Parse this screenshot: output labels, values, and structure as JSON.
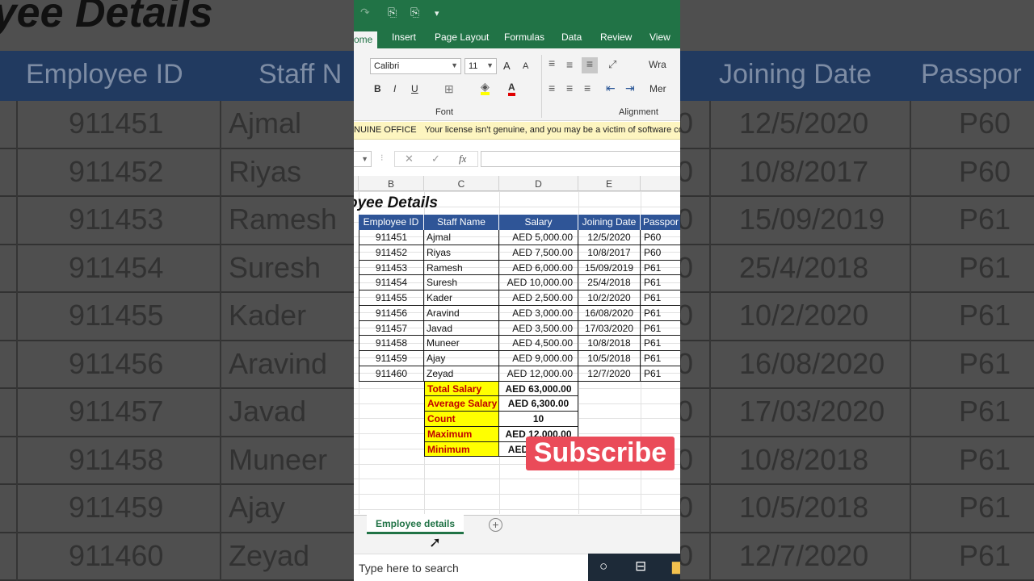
{
  "background": {
    "title": "oyee Details",
    "headers": [
      "Employee ID",
      "Staff N",
      "Joining Date",
      "Passpor"
    ],
    "rows": [
      {
        "id": "911451",
        "name": "Ajmal",
        "e": "0",
        "date": "12/5/2020",
        "p": "P60"
      },
      {
        "id": "911452",
        "name": "Riyas",
        "e": "0",
        "date": "10/8/2017",
        "p": "P60"
      },
      {
        "id": "911453",
        "name": "Ramesh",
        "e": "0",
        "date": "15/09/2019",
        "p": "P61"
      },
      {
        "id": "911454",
        "name": "Suresh",
        "e": "0",
        "date": "25/4/2018",
        "p": "P61"
      },
      {
        "id": "911455",
        "name": "Kader",
        "e": "0",
        "date": "10/2/2020",
        "p": "P61"
      },
      {
        "id": "911456",
        "name": "Aravind",
        "e": "0",
        "date": "16/08/2020",
        "p": "P61"
      },
      {
        "id": "911457",
        "name": "Javad",
        "e": "0",
        "date": "17/03/2020",
        "p": "P61"
      },
      {
        "id": "911458",
        "name": "Muneer",
        "e": "0",
        "date": "10/8/2018",
        "p": "P61"
      },
      {
        "id": "911459",
        "name": "Ajay",
        "e": "0",
        "date": "10/5/2018",
        "p": "P61"
      },
      {
        "id": "911460",
        "name": "Zeyad",
        "e": "0",
        "date": "12/7/2020",
        "p": "P61"
      }
    ]
  },
  "qat": {
    "redo": "↷",
    "icon1": "⎘",
    "icon2": "⎘",
    "more": "▾"
  },
  "ribbon_tabs": [
    "ome",
    "Insert",
    "Page Layout",
    "Formulas",
    "Data",
    "Review",
    "View"
  ],
  "ribbon": {
    "font_name": "Calibri",
    "font_size": "11",
    "grow": "A",
    "shrink": "A",
    "bold": "B",
    "italic": "I",
    "underline": "U",
    "font_color": "A",
    "wrap": "Wra",
    "merge": "Mer",
    "font_group": "Font",
    "alignment_group": "Alignment"
  },
  "message_bar": {
    "tag": "NUINE OFFICE",
    "text": "Your license isn't genuine, and you may be a victim of software co"
  },
  "formula_bar": {
    "cancel": "✕",
    "enter": "✓",
    "fx": "fx",
    "value": ""
  },
  "columns": [
    "B",
    "C",
    "D",
    "E"
  ],
  "sheet": {
    "title": "oyee Details",
    "headers": [
      "Employee ID",
      "Staff Name",
      "Salary",
      "Joining Date",
      "Passpor"
    ],
    "rows": [
      {
        "id": "911451",
        "name": "Ajmal",
        "salary": "AED 5,000.00",
        "date": "12/5/2020",
        "passport": "P60"
      },
      {
        "id": "911452",
        "name": "Riyas",
        "salary": "AED 7,500.00",
        "date": "10/8/2017",
        "passport": "P60"
      },
      {
        "id": "911453",
        "name": "Ramesh",
        "salary": "AED 6,000.00",
        "date": "15/09/2019",
        "passport": "P61"
      },
      {
        "id": "911454",
        "name": "Suresh",
        "salary": "AED 10,000.00",
        "date": "25/4/2018",
        "passport": "P61"
      },
      {
        "id": "911455",
        "name": "Kader",
        "salary": "AED 2,500.00",
        "date": "10/2/2020",
        "passport": "P61"
      },
      {
        "id": "911456",
        "name": "Aravind",
        "salary": "AED 3,000.00",
        "date": "16/08/2020",
        "passport": "P61"
      },
      {
        "id": "911457",
        "name": "Javad",
        "salary": "AED 3,500.00",
        "date": "17/03/2020",
        "passport": "P61"
      },
      {
        "id": "911458",
        "name": "Muneer",
        "salary": "AED 4,500.00",
        "date": "10/8/2018",
        "passport": "P61"
      },
      {
        "id": "911459",
        "name": "Ajay",
        "salary": "AED 9,000.00",
        "date": "10/5/2018",
        "passport": "P61"
      },
      {
        "id": "911460",
        "name": "Zeyad",
        "salary": "AED 12,000.00",
        "date": "12/7/2020",
        "passport": "P61"
      }
    ],
    "summary": [
      {
        "label": "Total Salary",
        "value": "AED 63,000.00"
      },
      {
        "label": "Average Salary",
        "value": "AED 6,300.00"
      },
      {
        "label": "Count",
        "value": "10"
      },
      {
        "label": "Maximum",
        "value": "AED 12,000.00"
      },
      {
        "label": "Minimum",
        "value": "AED 2,500.00"
      }
    ]
  },
  "overlay": {
    "subscribe": "Subscribe"
  },
  "sheet_tabs": {
    "active": "Employee details",
    "add": "+"
  },
  "taskbar": {
    "search_placeholder": "Type here to search"
  },
  "colors": {
    "excel_green": "#217346",
    "header_blue": "#2f5597",
    "summary_yellow": "#ffff00",
    "summary_red": "#c00000",
    "subscribe_red": "#ea4b59"
  }
}
